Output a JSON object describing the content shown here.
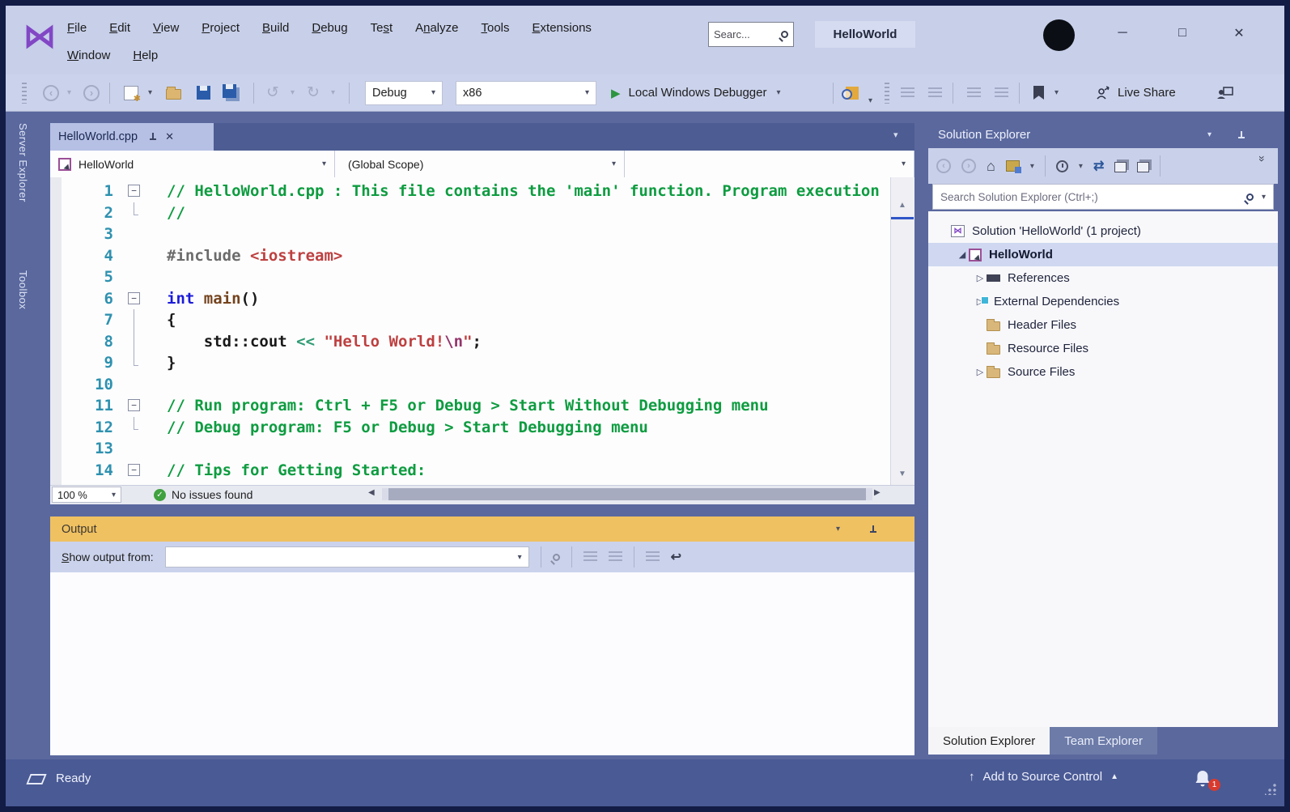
{
  "window": {
    "title": "HelloWorld",
    "search_value": "Searc...",
    "minimize": "─",
    "maximize": "□",
    "close": "✕"
  },
  "menu": {
    "row1": [
      {
        "label": "File",
        "u": 0
      },
      {
        "label": "Edit",
        "u": 0
      },
      {
        "label": "View",
        "u": 0
      },
      {
        "label": "Project",
        "u": 0
      },
      {
        "label": "Build",
        "u": 0
      },
      {
        "label": "Debug",
        "u": 0
      },
      {
        "label": "Test",
        "u": 2
      },
      {
        "label": "Analyze",
        "u": 1
      },
      {
        "label": "Tools",
        "u": 0
      },
      {
        "label": "Extensions",
        "u": 0
      }
    ],
    "row2": [
      {
        "label": "Window",
        "u": 0
      },
      {
        "label": "Help",
        "u": 0
      }
    ]
  },
  "toolbar": {
    "configuration": "Debug",
    "platform": "x86",
    "run_label": "Local Windows Debugger",
    "live_share_label": "Live Share"
  },
  "side_tabs": {
    "server_explorer": "Server Explorer",
    "toolbox": "Toolbox"
  },
  "editor": {
    "tab_title": "HelloWorld.cpp",
    "nav_project": "HelloWorld",
    "nav_scope": "(Global Scope)",
    "zoom_level": "100 %",
    "health_status": "No issues found",
    "code": {
      "lines": [
        {
          "n": "1",
          "fold": "minus",
          "segs": [
            {
              "t": "// HelloWorld.cpp : This file contains the 'main' function. Program execution",
              "c": "comment"
            }
          ]
        },
        {
          "n": "2",
          "guide": "end",
          "segs": [
            {
              "t": "//",
              "c": "comment"
            }
          ]
        },
        {
          "n": "3",
          "segs": []
        },
        {
          "n": "4",
          "segs": [
            {
              "t": "#include ",
              "c": "directive"
            },
            {
              "t": "<iostream>",
              "c": "string"
            }
          ]
        },
        {
          "n": "5",
          "segs": []
        },
        {
          "n": "6",
          "fold": "minus",
          "segs": [
            {
              "t": "int",
              "c": "keyword"
            },
            {
              "t": " ",
              "c": "plain"
            },
            {
              "t": "main",
              "c": "function"
            },
            {
              "t": "()",
              "c": "plain"
            }
          ]
        },
        {
          "n": "7",
          "guide": "mid",
          "segs": [
            {
              "t": "{",
              "c": "plain"
            }
          ]
        },
        {
          "n": "8",
          "guide": "mid",
          "segs": [
            {
              "t": "    std::cout ",
              "c": "plain"
            },
            {
              "t": "<< ",
              "c": "operator"
            },
            {
              "t": "\"Hello World!",
              "c": "string"
            },
            {
              "t": "\\n",
              "c": "escape"
            },
            {
              "t": "\"",
              "c": "string"
            },
            {
              "t": ";",
              "c": "plain"
            }
          ]
        },
        {
          "n": "9",
          "guide": "end",
          "segs": [
            {
              "t": "}",
              "c": "plain"
            }
          ]
        },
        {
          "n": "10",
          "segs": []
        },
        {
          "n": "11",
          "fold": "minus",
          "segs": [
            {
              "t": "// Run program: Ctrl + F5 or Debug > Start Without Debugging menu",
              "c": "comment"
            }
          ]
        },
        {
          "n": "12",
          "guide": "end",
          "segs": [
            {
              "t": "// Debug program: F5 or Debug > Start Debugging menu",
              "c": "comment"
            }
          ]
        },
        {
          "n": "13",
          "segs": []
        },
        {
          "n": "14",
          "fold": "minus",
          "segs": [
            {
              "t": "// Tips for Getting Started:",
              "c": "comment"
            }
          ]
        }
      ]
    }
  },
  "output": {
    "title": "Output",
    "show_output_label": "Show output from:",
    "combo_value": ""
  },
  "solution_explorer": {
    "title": "Solution Explorer",
    "search_placeholder": "Search Solution Explorer (Ctrl+;)",
    "tree": [
      {
        "label": "Solution 'HelloWorld' (1 project)",
        "icon": "solution",
        "level": 0,
        "expander": "none"
      },
      {
        "label": "HelloWorld",
        "icon": "cpp-project",
        "level": 1,
        "expander": "expanded",
        "bold": true,
        "selected": true
      },
      {
        "label": "References",
        "icon": "references",
        "level": 2,
        "expander": "collapsed"
      },
      {
        "label": "External Dependencies",
        "icon": "folder-deps",
        "level": 2,
        "expander": "collapsed"
      },
      {
        "label": "Header Files",
        "icon": "folder",
        "level": 2,
        "expander": "none"
      },
      {
        "label": "Resource Files",
        "icon": "folder",
        "level": 2,
        "expander": "none"
      },
      {
        "label": "Source Files",
        "icon": "folder",
        "level": 2,
        "expander": "collapsed"
      }
    ],
    "bottom_tabs": [
      {
        "label": "Solution Explorer",
        "active": true
      },
      {
        "label": "Team Explorer",
        "active": false
      }
    ]
  },
  "status_bar": {
    "ready": "Ready",
    "source_control": "Add to Source Control",
    "notification_count": "1"
  },
  "icons": {
    "logo": "⋈",
    "chevron-down": "▾",
    "back-arrow": "‹",
    "forward-arrow": "›",
    "undo": "↺",
    "redo": "↻",
    "play": "▶",
    "scroll-up": "▲",
    "scroll-down": "▼",
    "scroll-left": "◀",
    "scroll-right": "▶",
    "splitter": "‡",
    "home": "⌂",
    "sync": "⇄",
    "overflow": "»",
    "check": "✓",
    "expander-collapsed": "▷",
    "expander-expanded": "◢",
    "up-arrow": "↑",
    "tri-up": "▲",
    "word-wrap": "↩",
    "fold-minus": "−"
  },
  "colors": {
    "titlebar": "#c7cfe9",
    "toolbar": "#cbd3ec",
    "shell": "#5a689e",
    "tabstrip": "#4d5c92",
    "active_tab": "#b5c0e4",
    "output_header": "#f0c161",
    "statusbar": "#4a5a95",
    "comment": "#0e9c40",
    "keyword": "#1b1bd8",
    "string": "#be4040",
    "line_number": "#2e91af",
    "accent_purple": "#8247c5",
    "badge_red": "#d83b2e"
  }
}
